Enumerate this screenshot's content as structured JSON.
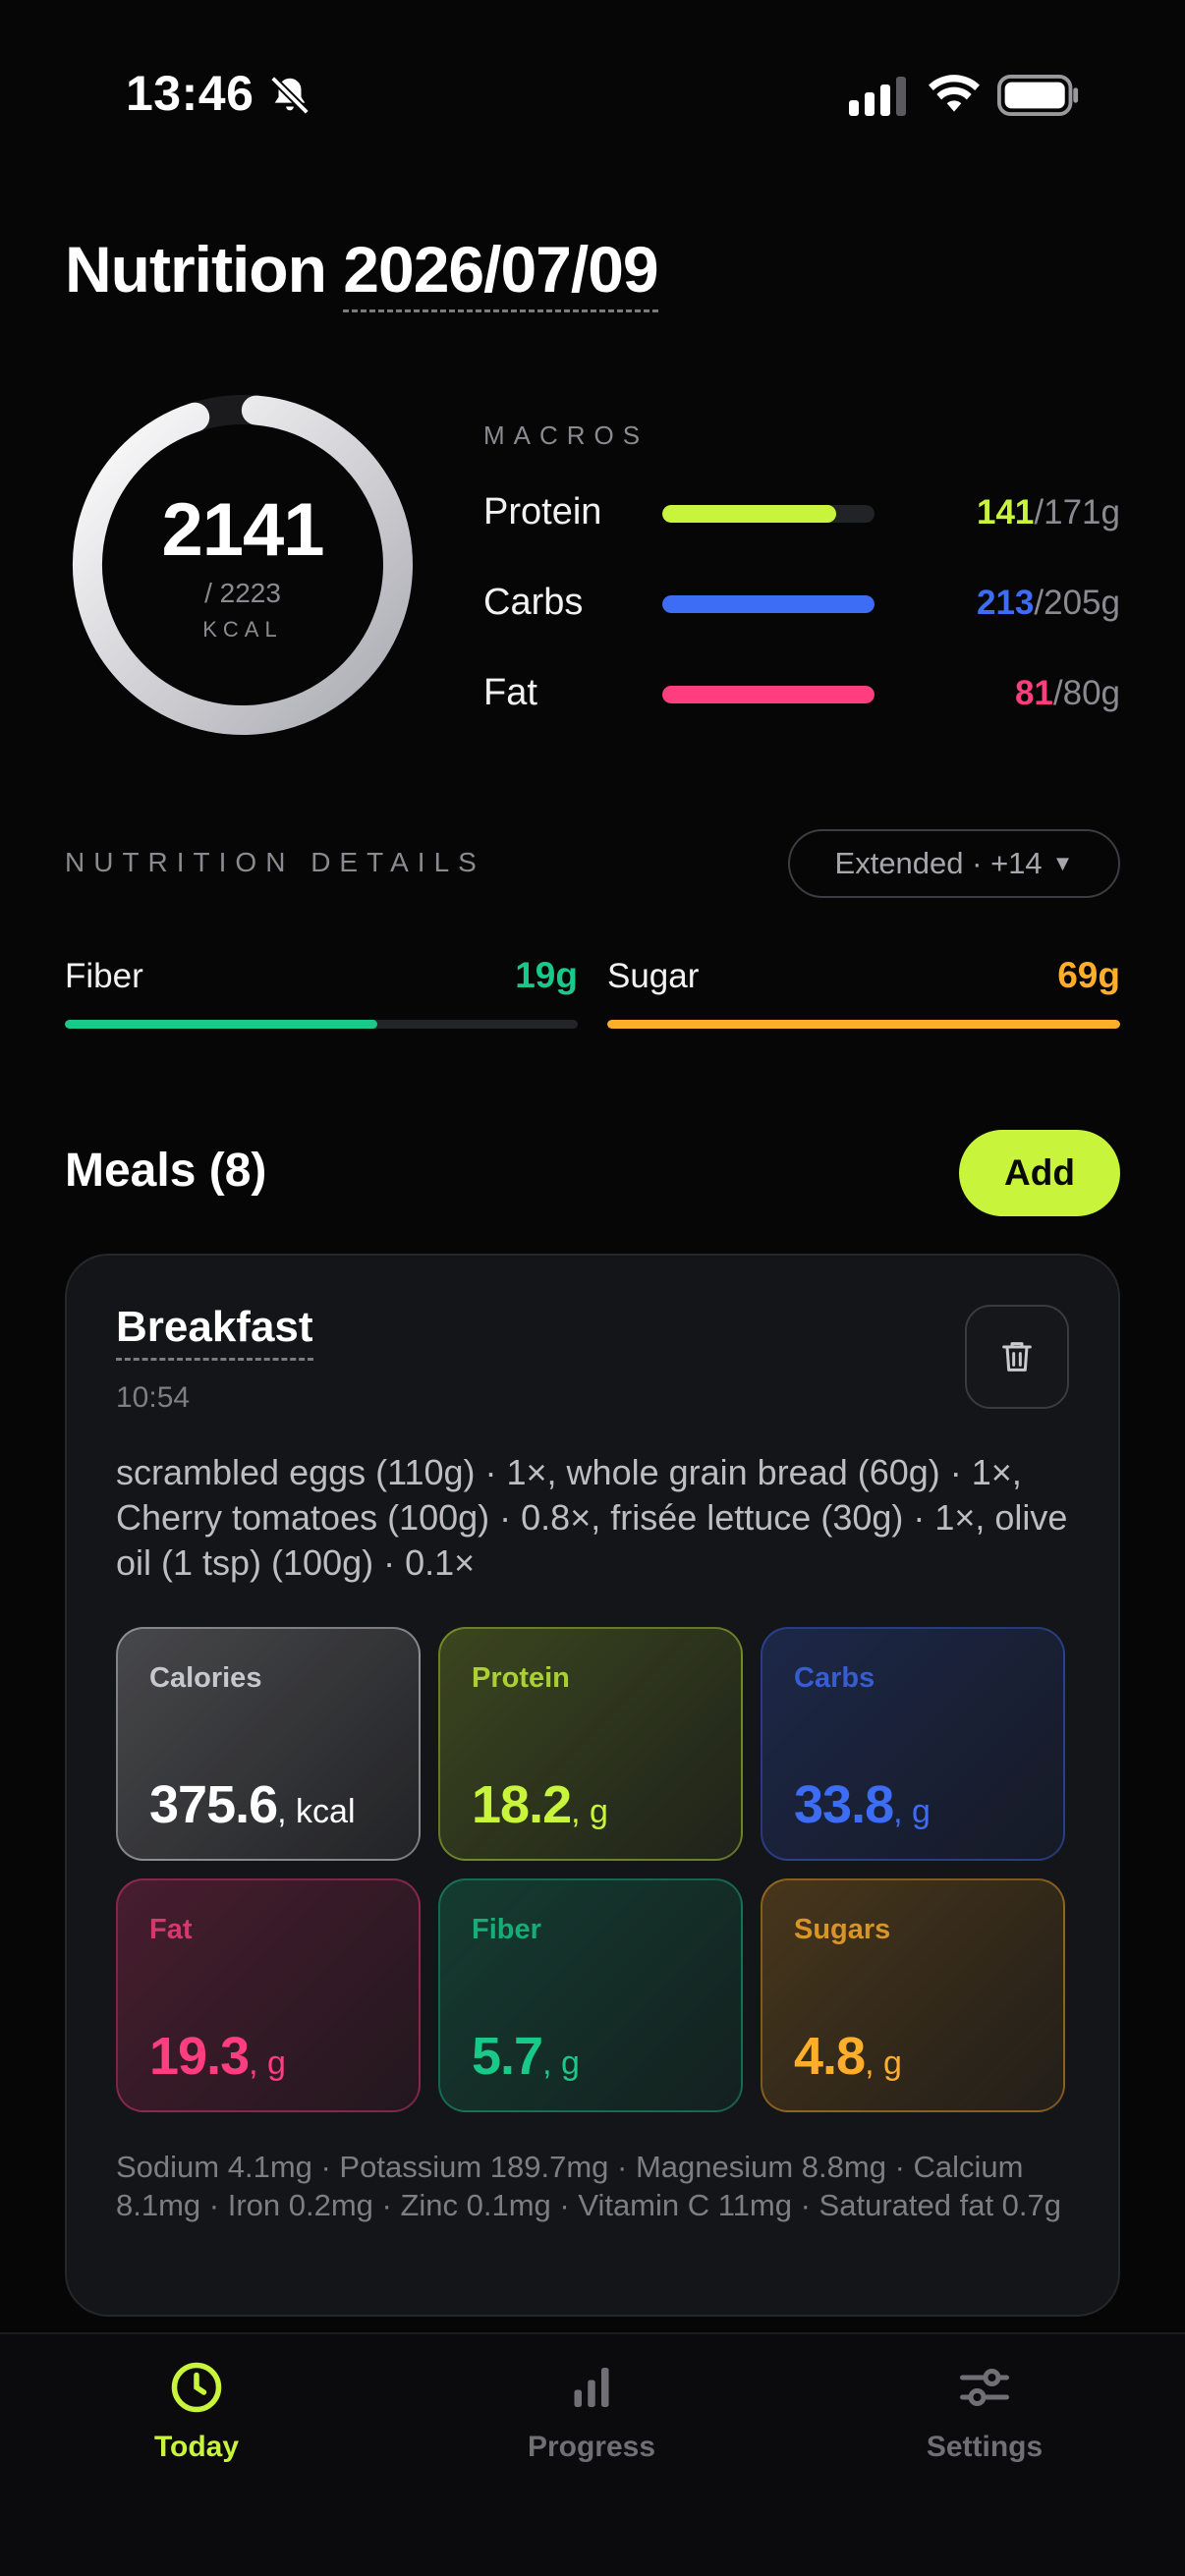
{
  "status_bar": {
    "time": "13:46"
  },
  "header": {
    "title": "Nutrition",
    "date": "2026/07/09"
  },
  "calories": {
    "value": "2141",
    "goal": "/ 2223",
    "unit": "KCAL",
    "fraction": 0.963
  },
  "macros": {
    "label": "MACROS",
    "items": [
      {
        "name": "Protein",
        "value": "141",
        "goal": "/171g",
        "fraction": 0.82,
        "color": "#c8f53b"
      },
      {
        "name": "Carbs",
        "value": "213",
        "goal": "/205g",
        "fraction": 1.0,
        "color": "#3d6cf5"
      },
      {
        "name": "Fat",
        "value": "81",
        "goal": "/80g",
        "fraction": 1.0,
        "color": "#ff3d7f"
      }
    ]
  },
  "details": {
    "label": "NUTRITION DETAILS",
    "dropdown": "Extended · +14",
    "items": [
      {
        "name": "Fiber",
        "value": "19g",
        "fraction": 0.61,
        "color": "#19c98a"
      },
      {
        "name": "Sugar",
        "value": "69g",
        "fraction": 1.0,
        "color": "#ffae2b"
      }
    ]
  },
  "meals": {
    "title": "Meals (8)",
    "add_label": "Add",
    "card": {
      "name": "Breakfast",
      "time": "10:54",
      "description": "scrambled eggs (110g) · 1×, whole grain bread (60g) · 1×, Cherry tomatoes (100g) · 0.8×, frisée lettuce (30g) · 1×, olive oil (1 tsp) (100g) · 0.1×",
      "tiles": [
        {
          "label": "Calories",
          "value": "375.6",
          "unit": ", kcal",
          "color": "#ffffff"
        },
        {
          "label": "Protein",
          "value": "18.2",
          "unit": ", g",
          "color": "#c8f53b"
        },
        {
          "label": "Carbs",
          "value": "33.8",
          "unit": ", g",
          "color": "#3d6cf5"
        },
        {
          "label": "Fat",
          "value": "19.3",
          "unit": ", g",
          "color": "#ff3d7f"
        },
        {
          "label": "Fiber",
          "value": "5.7",
          "unit": ", g",
          "color": "#19c98a"
        },
        {
          "label": "Sugars",
          "value": "4.8",
          "unit": ", g",
          "color": "#ffae2b"
        }
      ],
      "micros": "Sodium 4.1mg  ·  Potassium 189.7mg  ·  Magnesium 8.8mg  ·  Calcium 8.1mg  ·  Iron 0.2mg  ·  Zinc 0.1mg  ·  Vitamin C 11mg  ·  Saturated fat 0.7g"
    }
  },
  "tabbar": {
    "items": [
      {
        "label": "Today",
        "icon": "clock-icon",
        "active": true
      },
      {
        "label": "Progress",
        "icon": "bar-chart-icon",
        "active": false
      },
      {
        "label": "Settings",
        "icon": "sliders-icon",
        "active": false
      }
    ]
  },
  "colors": {
    "accent": "#c8f53b",
    "background": "#060607",
    "card": "#141518"
  }
}
